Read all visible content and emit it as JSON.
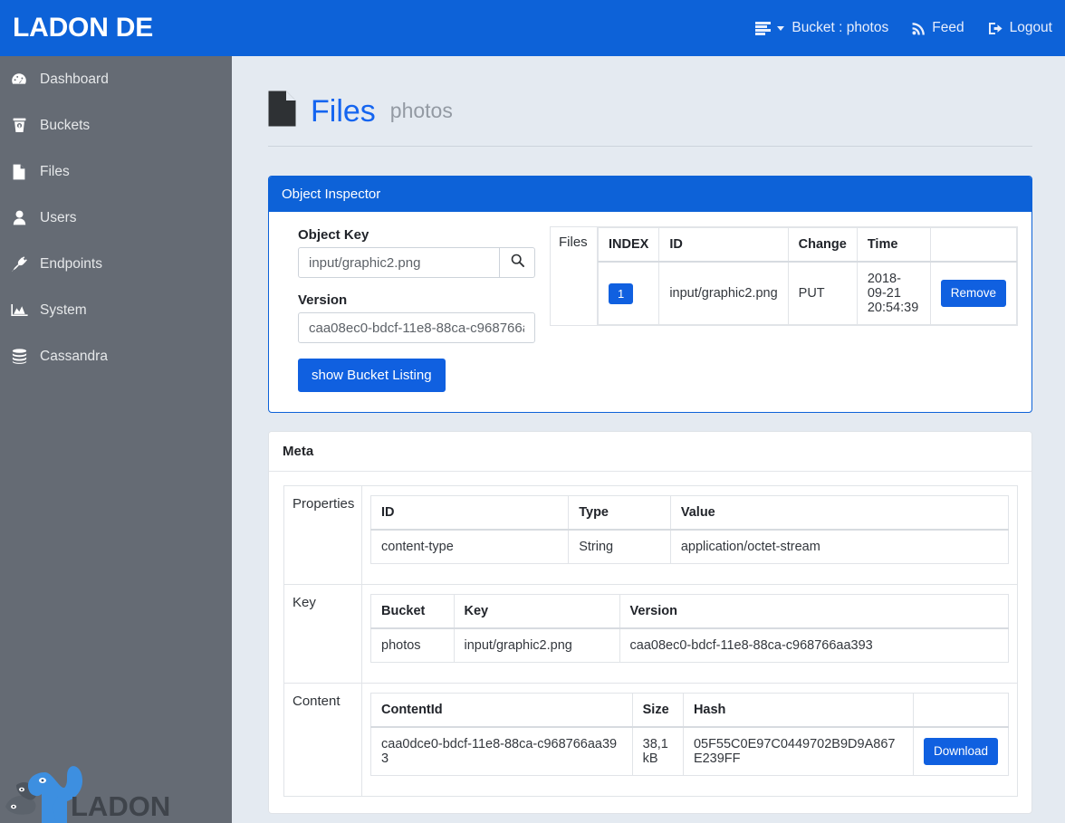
{
  "navbar": {
    "brand": "LADON DE",
    "items": [
      {
        "icon": "server-list-icon",
        "label": "Bucket : photos",
        "has_caret": true
      },
      {
        "icon": "rss-feed-icon",
        "label": "Feed",
        "has_caret": false
      },
      {
        "icon": "logout-icon",
        "label": "Logout",
        "has_caret": false
      }
    ]
  },
  "sidebar": {
    "items": [
      {
        "icon": "dashboard-icon",
        "label": "Dashboard"
      },
      {
        "icon": "bucket-icon",
        "label": "Buckets"
      },
      {
        "icon": "file-icon",
        "label": "Files"
      },
      {
        "icon": "user-icon",
        "label": "Users"
      },
      {
        "icon": "plug-icon",
        "label": "Endpoints"
      },
      {
        "icon": "chart-area-icon",
        "label": "System"
      },
      {
        "icon": "database-icon",
        "label": "Cassandra"
      }
    ],
    "logo_text": "LADON"
  },
  "page": {
    "icon": "file-icon",
    "title": "Files",
    "subtitle": "photos"
  },
  "inspector": {
    "panel_title": "Object Inspector",
    "object_key_label": "Object Key",
    "object_key_value": "input/graphic2.png",
    "object_key_placeholder": "Object Key",
    "search_icon": "search-icon",
    "version_label": "Version",
    "version_value": "caa08ec0-bdcf-11e8-88ca-c968766aa393",
    "version_placeholder": "Version",
    "show_listing_button": "show Bucket Listing",
    "files_section_label": "Files",
    "files_table": {
      "headers": [
        "INDEX",
        "ID",
        "Change",
        "Time",
        ""
      ],
      "rows": [
        {
          "index": "1",
          "id": "input/graphic2.png",
          "change": "PUT",
          "time": "2018-09-21 20:54:39",
          "action": "Remove"
        }
      ]
    }
  },
  "meta": {
    "panel_title": "Meta",
    "properties_label": "Properties",
    "properties_table": {
      "headers": [
        "ID",
        "Type",
        "Value"
      ],
      "rows": [
        {
          "id": "content-type",
          "type": "String",
          "value": "application/octet-stream"
        }
      ]
    },
    "key_label": "Key",
    "key_table": {
      "headers": [
        "Bucket",
        "Key",
        "Version"
      ],
      "rows": [
        {
          "bucket": "photos",
          "key": "input/graphic2.png",
          "version": "caa08ec0-bdcf-11e8-88ca-c968766aa393"
        }
      ]
    },
    "content_label": "Content",
    "content_table": {
      "headers": [
        "ContentId",
        "Size",
        "Hash",
        ""
      ],
      "rows": [
        {
          "content_id": "caa0dce0-bdcf-11e8-88ca-c968766aa393",
          "size": "38,1 kB",
          "hash": "05F55C0E97C0449702B9D9A867E239FF",
          "action": "Download"
        }
      ]
    }
  },
  "colors": {
    "brand_blue": "#0d62d8",
    "sidebar_gray": "#656b74",
    "content_bg": "#e4eaf1",
    "link_blue": "#1565f0",
    "success_green": "#88d07a",
    "logo_blue": "#3d8fe0"
  }
}
